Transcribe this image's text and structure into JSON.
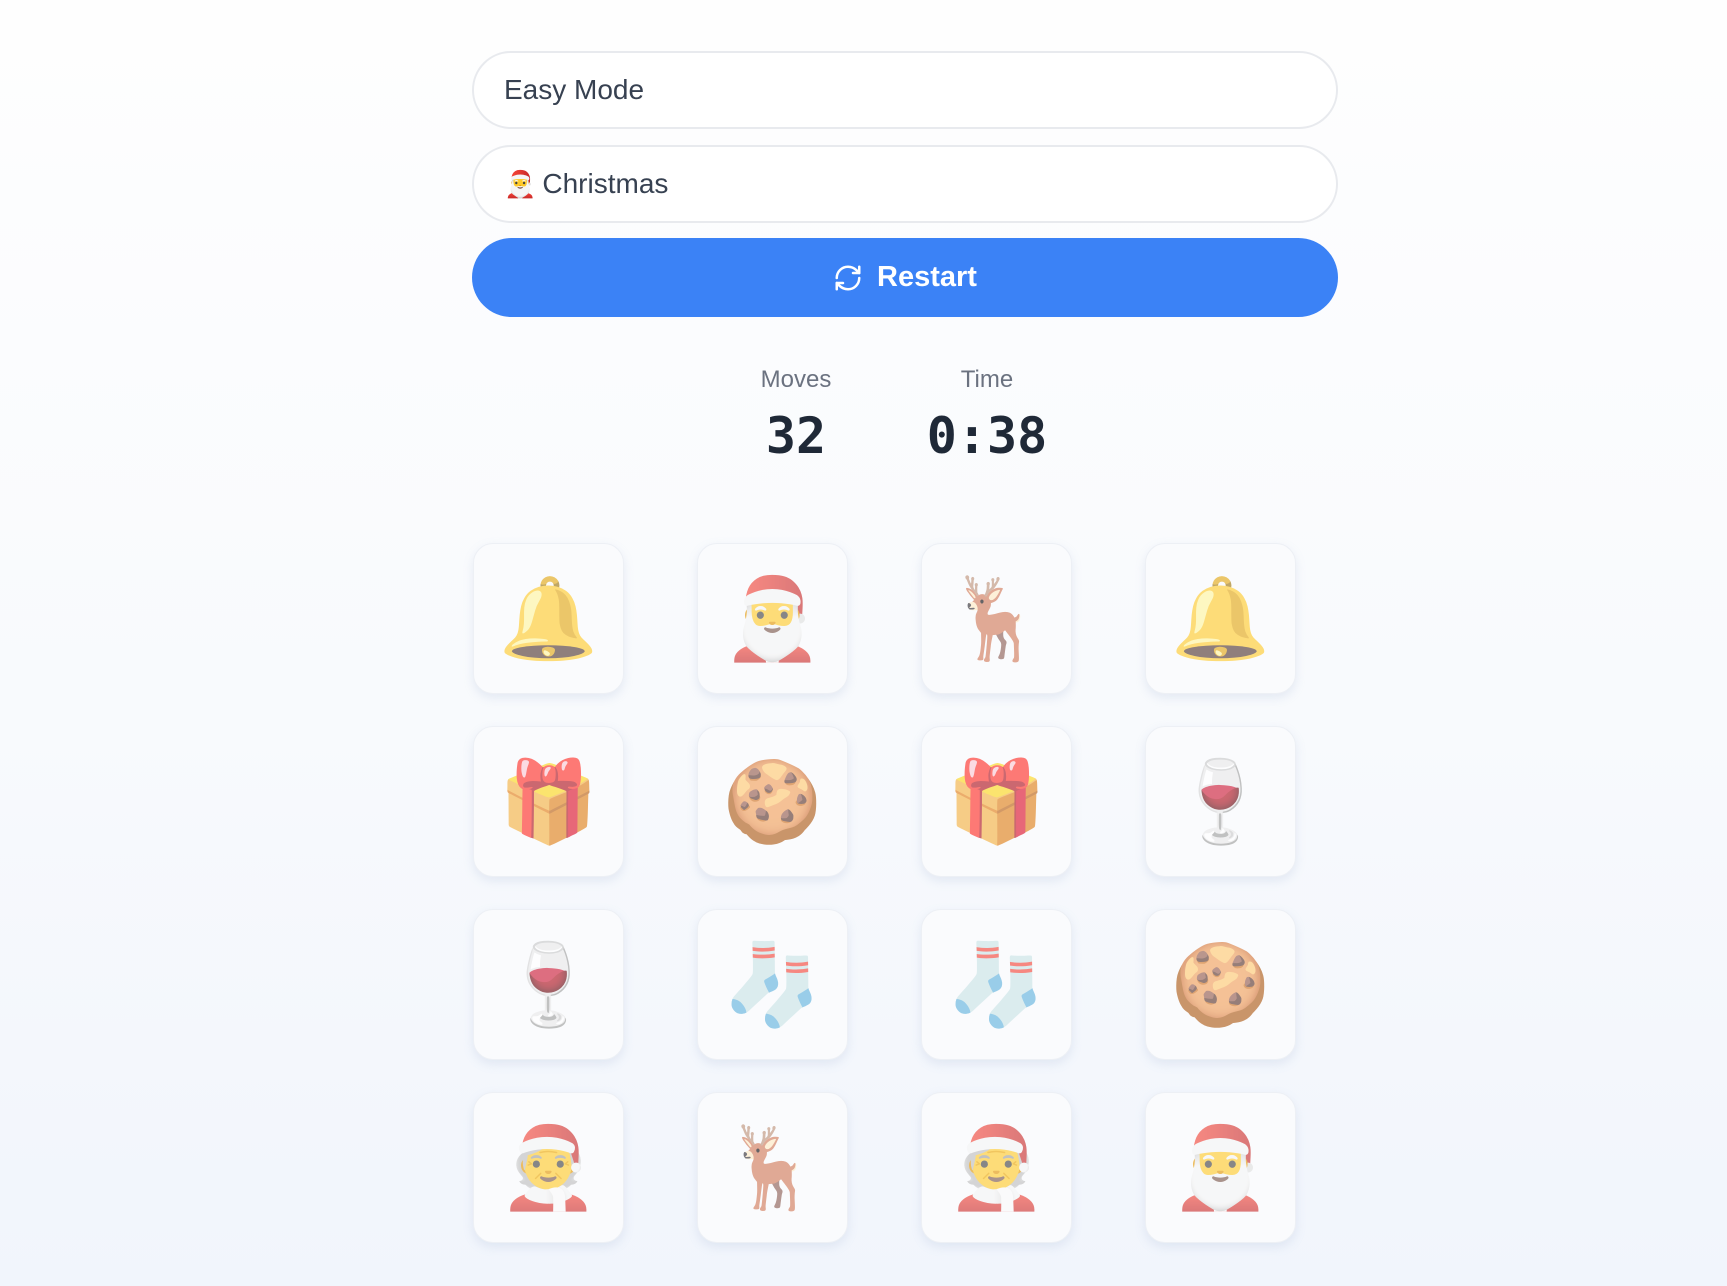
{
  "controls": {
    "difficulty": {
      "value": "Easy Mode"
    },
    "theme": {
      "icon": "🎅",
      "value": "Christmas"
    },
    "restart": {
      "label": "Restart",
      "icon": "refresh-icon"
    }
  },
  "stats": {
    "moves": {
      "label": "Moves",
      "value": "32"
    },
    "time": {
      "label": "Time",
      "value": "0:38"
    }
  },
  "colors": {
    "accent": "#3b82f6",
    "text": "#374151",
    "muted": "#6b7280",
    "stat_value": "#1f2937"
  },
  "board": {
    "rows": 4,
    "cols": 4,
    "state": "matched",
    "cards": [
      {
        "emoji": "🔔",
        "name": "bell"
      },
      {
        "emoji": "🎅",
        "name": "santa"
      },
      {
        "emoji": "🦌",
        "name": "deer"
      },
      {
        "emoji": "🔔",
        "name": "bell"
      },
      {
        "emoji": "🎁",
        "name": "gift"
      },
      {
        "emoji": "🍪",
        "name": "cookie"
      },
      {
        "emoji": "🎁",
        "name": "gift"
      },
      {
        "emoji": "🍷",
        "name": "wine-glass"
      },
      {
        "emoji": "🍷",
        "name": "wine-glass"
      },
      {
        "emoji": "🧦",
        "name": "socks"
      },
      {
        "emoji": "🧦",
        "name": "socks"
      },
      {
        "emoji": "🍪",
        "name": "cookie"
      },
      {
        "emoji": "🧑‍🎄",
        "name": "mx-claus"
      },
      {
        "emoji": "🦌",
        "name": "deer"
      },
      {
        "emoji": "🧑‍🎄",
        "name": "mx-claus"
      },
      {
        "emoji": "🎅",
        "name": "santa"
      }
    ]
  }
}
